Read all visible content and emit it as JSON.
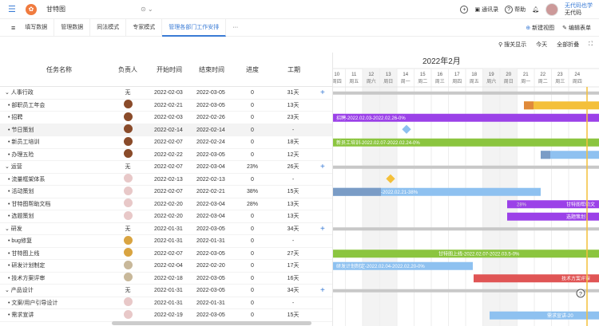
{
  "app": {
    "title": "甘特图",
    "menu_icon": "list-icon",
    "logo_icon": "orange-circle-icon"
  },
  "topbar": {
    "contacts": "通讯录",
    "help": "帮助",
    "user_name": "无代码也学",
    "user_sub": "无代码"
  },
  "tabs": [
    "填写数据",
    "管理数据",
    "同法模式",
    "专家模式",
    "管理各部门工作安排"
  ],
  "tabs_more": "···",
  "tabs_right": {
    "new_view": "新建视图",
    "edit": "编辑表单"
  },
  "toolbar": {
    "search": "搜关显示",
    "today": "今天",
    "collapse": "全部折叠"
  },
  "columns": {
    "name": "任务名称",
    "owner": "负责人",
    "start": "开始时间",
    "end": "结束时间",
    "progress": "进度",
    "duration": "工期"
  },
  "rows": [
    {
      "name": "⌄ 人事行政",
      "owner": "无",
      "start": "2022-02-03",
      "end": "2022-03-05",
      "progress": "0",
      "duration": "31天",
      "group": true
    },
    {
      "name": "• 部职员工年会",
      "owner": "av",
      "start": "2022-02-21",
      "end": "2022-03-05",
      "progress": "0",
      "duration": "13天"
    },
    {
      "name": "• 招聘",
      "owner": "av",
      "start": "2022-02-03",
      "end": "2022-02-26",
      "progress": "0",
      "duration": "23天"
    },
    {
      "name": "• 节日策划",
      "owner": "av",
      "start": "2022-02-14",
      "end": "2022-02-14",
      "progress": "0",
      "duration": "-",
      "hl": true
    },
    {
      "name": "• 新员工培训",
      "owner": "av",
      "start": "2022-02-07",
      "end": "2022-02-24",
      "progress": "0",
      "duration": "18天"
    },
    {
      "name": "• 办理五险",
      "owner": "av",
      "start": "2022-02-22",
      "end": "2022-03-05",
      "progress": "0",
      "duration": "12天"
    },
    {
      "name": "⌄ 运营",
      "owner": "无",
      "start": "2022-02-07",
      "end": "2022-03-04",
      "progress": "23%",
      "duration": "26天",
      "group": true
    },
    {
      "name": "• 流量框架体系",
      "owner": "av2",
      "start": "2022-02-13",
      "end": "2022-02-13",
      "progress": "0",
      "duration": "-"
    },
    {
      "name": "• 活动策划",
      "owner": "av2",
      "start": "2022-02-07",
      "end": "2022-02-21",
      "progress": "38%",
      "duration": "15天"
    },
    {
      "name": "• 甘特图帮助文档",
      "owner": "av2",
      "start": "2022-02-20",
      "end": "2022-03-04",
      "progress": "28%",
      "duration": "13天"
    },
    {
      "name": "• 选题策划",
      "owner": "av2",
      "start": "2022-02-20",
      "end": "2022-03-04",
      "progress": "0",
      "duration": "13天"
    },
    {
      "name": "⌄ 研发",
      "owner": "无",
      "start": "2022-01-31",
      "end": "2022-03-05",
      "progress": "0",
      "duration": "34天",
      "group": true
    },
    {
      "name": "• bug修复",
      "owner": "av3",
      "start": "2022-01-31",
      "end": "2022-01-31",
      "progress": "0",
      "duration": "-"
    },
    {
      "name": "• 甘特图上线",
      "owner": "av3",
      "start": "2022-02-07",
      "end": "2022-03-05",
      "progress": "0",
      "duration": "27天"
    },
    {
      "name": "• 研发计划制定",
      "owner": "av4",
      "start": "2022-02-04",
      "end": "2022-02-20",
      "progress": "0",
      "duration": "17天"
    },
    {
      "name": "• 技术方案评审",
      "owner": "av4",
      "start": "2022-02-18",
      "end": "2022-03-05",
      "progress": "0",
      "duration": "16天"
    },
    {
      "name": "⌄ 产品设计",
      "owner": "无",
      "start": "2022-01-31",
      "end": "2022-03-05",
      "progress": "0",
      "duration": "34天",
      "group": true
    },
    {
      "name": "• 文案/用户引导设计",
      "owner": "av2",
      "start": "2022-01-31",
      "end": "2022-01-31",
      "progress": "0",
      "duration": "-"
    },
    {
      "name": "• 需求宣讲",
      "owner": "av2",
      "start": "2022-02-19",
      "end": "2022-03-05",
      "progress": "0",
      "duration": "15天"
    }
  ],
  "gantt": {
    "month": "2022年2月",
    "days": [
      {
        "d": "10",
        "w": "周四"
      },
      {
        "d": "11",
        "w": "周五"
      },
      {
        "d": "12",
        "w": "周六"
      },
      {
        "d": "13",
        "w": "周日"
      },
      {
        "d": "14",
        "w": "周一"
      },
      {
        "d": "15",
        "w": "周二"
      },
      {
        "d": "16",
        "w": "周三"
      },
      {
        "d": "17",
        "w": "周四"
      },
      {
        "d": "18",
        "w": "周五"
      },
      {
        "d": "19",
        "w": "周六"
      },
      {
        "d": "20",
        "w": "周日"
      },
      {
        "d": "21",
        "w": "周一"
      },
      {
        "d": "22",
        "w": "周二"
      },
      {
        "d": "23",
        "w": "周三"
      },
      {
        "d": "24",
        "w": "周四"
      }
    ],
    "bar_labels": {
      "r2": "招聘-2022.02.03-2022.02.26-0%",
      "r4": "新员工培训-2022.02.07-2022.02.24-0%",
      "r8": "活动策划-2022.02.07-2022.02.21-38%",
      "r9": "甘特图帮助文",
      "r9b": "28%",
      "r10": "选题策划",
      "r13": "甘特图上线-2022.02.07-2022.03.5-0%",
      "r14": "研发计划制定-2022.02.04-2022.02.20-0%",
      "r15": "技术方案评审",
      "r18": "需求宣讲-20"
    },
    "colors": {
      "yellow": "#f4c03a",
      "purple": "#9b41e8",
      "green": "#8bc53f",
      "blue": "#8ec1f0",
      "red": "#e05555",
      "steel": "#7a9cc6",
      "gray": "#c8c8c8"
    }
  }
}
